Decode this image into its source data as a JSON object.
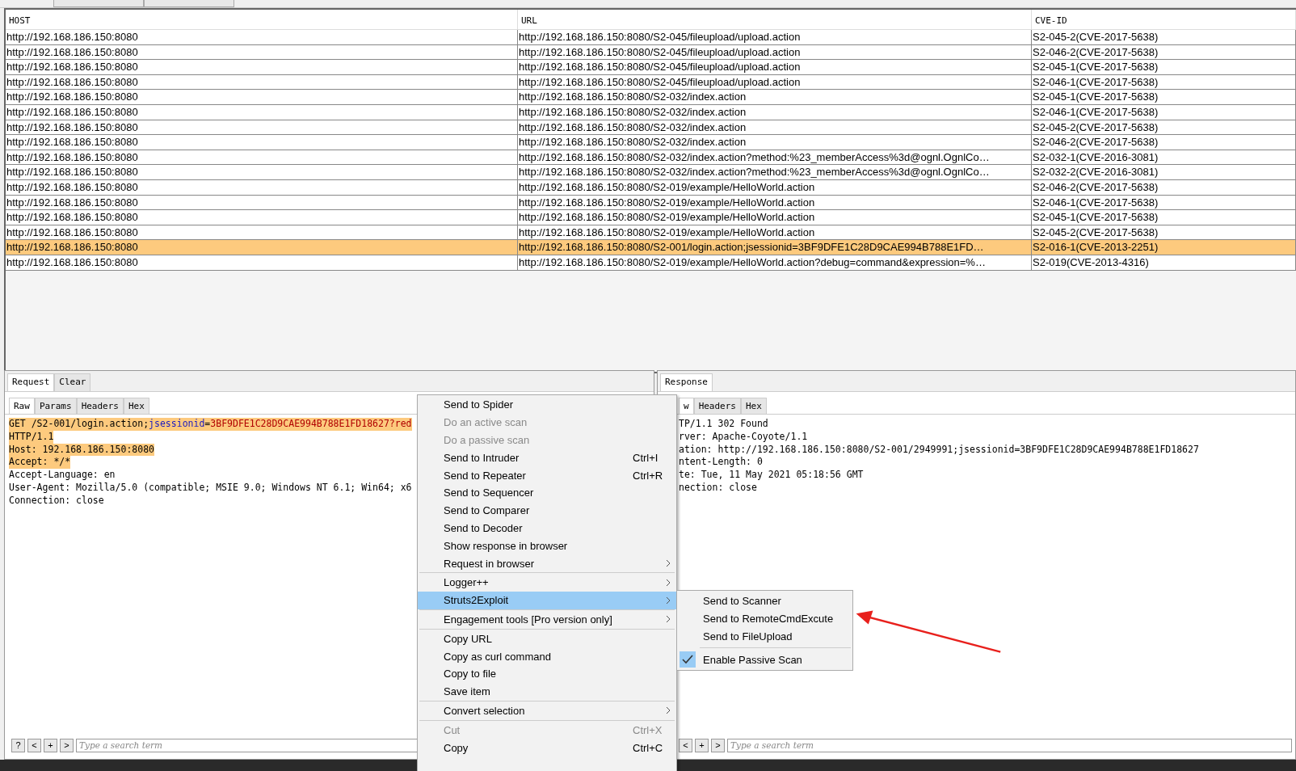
{
  "top_tabs": [
    {
      "selected": false
    },
    {
      "selected": false
    }
  ],
  "table": {
    "columns": [
      "HOST",
      "URL",
      "CVE-ID"
    ],
    "rows": [
      {
        "host": "http://192.168.186.150:8080",
        "url": "http://192.168.186.150:8080/S2-045/fileupload/upload.action",
        "cve_id": "S2-045-2(CVE-2017-5638)",
        "selected": false
      },
      {
        "host": "http://192.168.186.150:8080",
        "url": "http://192.168.186.150:8080/S2-045/fileupload/upload.action",
        "cve_id": "S2-046-2(CVE-2017-5638)",
        "selected": false
      },
      {
        "host": "http://192.168.186.150:8080",
        "url": "http://192.168.186.150:8080/S2-045/fileupload/upload.action",
        "cve_id": "S2-045-1(CVE-2017-5638)",
        "selected": false
      },
      {
        "host": "http://192.168.186.150:8080",
        "url": "http://192.168.186.150:8080/S2-045/fileupload/upload.action",
        "cve_id": "S2-046-1(CVE-2017-5638)",
        "selected": false
      },
      {
        "host": "http://192.168.186.150:8080",
        "url": "http://192.168.186.150:8080/S2-032/index.action",
        "cve_id": "S2-045-1(CVE-2017-5638)",
        "selected": false
      },
      {
        "host": "http://192.168.186.150:8080",
        "url": "http://192.168.186.150:8080/S2-032/index.action",
        "cve_id": "S2-046-1(CVE-2017-5638)",
        "selected": false
      },
      {
        "host": "http://192.168.186.150:8080",
        "url": "http://192.168.186.150:8080/S2-032/index.action",
        "cve_id": "S2-045-2(CVE-2017-5638)",
        "selected": false
      },
      {
        "host": "http://192.168.186.150:8080",
        "url": "http://192.168.186.150:8080/S2-032/index.action",
        "cve_id": "S2-046-2(CVE-2017-5638)",
        "selected": false
      },
      {
        "host": "http://192.168.186.150:8080",
        "url": "http://192.168.186.150:8080/S2-032/index.action?method:%23_memberAccess%3d@ognl.OgnlCo…",
        "cve_id": "S2-032-1(CVE-2016-3081)",
        "selected": false
      },
      {
        "host": "http://192.168.186.150:8080",
        "url": "http://192.168.186.150:8080/S2-032/index.action?method:%23_memberAccess%3d@ognl.OgnlCo…",
        "cve_id": "S2-032-2(CVE-2016-3081)",
        "selected": false
      },
      {
        "host": "http://192.168.186.150:8080",
        "url": "http://192.168.186.150:8080/S2-019/example/HelloWorld.action",
        "cve_id": "S2-046-2(CVE-2017-5638)",
        "selected": false
      },
      {
        "host": "http://192.168.186.150:8080",
        "url": "http://192.168.186.150:8080/S2-019/example/HelloWorld.action",
        "cve_id": "S2-046-1(CVE-2017-5638)",
        "selected": false
      },
      {
        "host": "http://192.168.186.150:8080",
        "url": "http://192.168.186.150:8080/S2-019/example/HelloWorld.action",
        "cve_id": "S2-045-1(CVE-2017-5638)",
        "selected": false
      },
      {
        "host": "http://192.168.186.150:8080",
        "url": "http://192.168.186.150:8080/S2-019/example/HelloWorld.action",
        "cve_id": "S2-045-2(CVE-2017-5638)",
        "selected": false
      },
      {
        "host": "http://192.168.186.150:8080",
        "url": "http://192.168.186.150:8080/S2-001/login.action;jsessionid=3BF9DFE1C28D9CAE994B788E1FD…",
        "cve_id": "S2-016-1(CVE-2013-2251)",
        "selected": true
      },
      {
        "host": "http://192.168.186.150:8080",
        "url": "http://192.168.186.150:8080/S2-019/example/HelloWorld.action?debug=command&expression=%…",
        "cve_id": "S2-019(CVE-2013-4316)",
        "selected": false
      }
    ]
  },
  "request": {
    "tabs": [
      {
        "label": "Request",
        "selected": true
      },
      {
        "label": "Clear",
        "selected": false
      }
    ],
    "subtabs": [
      {
        "label": "Raw",
        "selected": true
      },
      {
        "label": "Params",
        "selected": false
      },
      {
        "label": "Headers",
        "selected": false
      },
      {
        "label": "Hex",
        "selected": false
      }
    ],
    "lines": [
      {
        "selected": true,
        "segments": [
          {
            "kind": "plain",
            "text": "GET /S2-001/login.action;"
          },
          {
            "kind": "key",
            "text": "jsessionid"
          },
          {
            "kind": "plain",
            "text": "="
          },
          {
            "kind": "value",
            "text": "3BF9DFE1C28D9CAE994B788E1FD18627?red"
          }
        ]
      },
      {
        "selected": true,
        "segments": [
          {
            "kind": "plain",
            "text": "HTTP/1.1"
          }
        ]
      },
      {
        "selected": true,
        "segments": [
          {
            "kind": "plain",
            "text": "Host: 192.168.186.150:8080"
          }
        ]
      },
      {
        "selected": true,
        "segments": [
          {
            "kind": "plain",
            "text": "Accept: */*"
          }
        ]
      },
      {
        "selected": false,
        "segments": [
          {
            "kind": "plain",
            "text": "Accept-Language: en"
          }
        ]
      },
      {
        "selected": false,
        "segments": [
          {
            "kind": "plain",
            "text": "User-Agent: Mozilla/5.0 (compatible; MSIE 9.0; Windows NT 6.1; Win64; x6"
          }
        ]
      },
      {
        "selected": false,
        "segments": [
          {
            "kind": "plain",
            "text": "Connection: close"
          }
        ]
      }
    ],
    "search_buttons": [
      "?",
      "<",
      "+",
      ">"
    ],
    "search": {
      "placeholder": "Type a search term"
    }
  },
  "response": {
    "tabs": [
      {
        "label": "Response",
        "selected": true
      }
    ],
    "subtabs": [
      {
        "label": "w",
        "selected": true
      },
      {
        "label": "Headers",
        "selected": false
      },
      {
        "label": "Hex",
        "selected": false
      }
    ],
    "lines": [
      "TP/1.1 302 Found",
      "rver: Apache-Coyote/1.1",
      "ation: http://192.168.186.150:8080/S2-001/2949991;jsessionid=3BF9DFE1C28D9CAE994B788E1FD18627",
      "ntent-Length: 0",
      "te: Tue, 11 May 2021 05:18:56 GMT",
      "nection: close"
    ],
    "search_buttons": [
      "<",
      "+",
      ">"
    ],
    "search": {
      "placeholder": "Type a search term"
    }
  },
  "context_menu": {
    "items": [
      {
        "kind": "item",
        "label": "Send to Spider",
        "disabled": false,
        "submenu": false,
        "selected": false
      },
      {
        "kind": "item",
        "label": "Do an active scan",
        "disabled": true,
        "submenu": false,
        "selected": false
      },
      {
        "kind": "item",
        "label": "Do a passive scan",
        "disabled": true,
        "submenu": false,
        "selected": false
      },
      {
        "kind": "item",
        "label": "Send to Intruder",
        "shortcut": "Ctrl+I",
        "disabled": false,
        "submenu": false,
        "selected": false
      },
      {
        "kind": "item",
        "label": "Send to Repeater",
        "shortcut": "Ctrl+R",
        "disabled": false,
        "submenu": false,
        "selected": false
      },
      {
        "kind": "item",
        "label": "Send to Sequencer",
        "disabled": false,
        "submenu": false,
        "selected": false
      },
      {
        "kind": "item",
        "label": "Send to Comparer",
        "disabled": false,
        "submenu": false,
        "selected": false
      },
      {
        "kind": "item",
        "label": "Send to Decoder",
        "disabled": false,
        "submenu": false,
        "selected": false
      },
      {
        "kind": "item",
        "label": "Show response in browser",
        "disabled": false,
        "submenu": false,
        "selected": false
      },
      {
        "kind": "item",
        "label": "Request in browser",
        "disabled": false,
        "submenu": true,
        "selected": false
      },
      {
        "kind": "separator"
      },
      {
        "kind": "item",
        "label": "Logger++",
        "disabled": false,
        "submenu": true,
        "selected": false
      },
      {
        "kind": "item",
        "label": "Struts2Exploit",
        "disabled": false,
        "submenu": true,
        "selected": true
      },
      {
        "kind": "separator"
      },
      {
        "kind": "item",
        "label": "Engagement tools [Pro version only]",
        "disabled": false,
        "submenu": true,
        "selected": false
      },
      {
        "kind": "separator"
      },
      {
        "kind": "item",
        "label": "Copy URL",
        "disabled": false,
        "submenu": false,
        "selected": false
      },
      {
        "kind": "item",
        "label": "Copy as curl command",
        "disabled": false,
        "submenu": false,
        "selected": false
      },
      {
        "kind": "item",
        "label": "Copy to file",
        "disabled": false,
        "submenu": false,
        "selected": false
      },
      {
        "kind": "item",
        "label": "Save item",
        "disabled": false,
        "submenu": false,
        "selected": false
      },
      {
        "kind": "separator"
      },
      {
        "kind": "item",
        "label": "Convert selection",
        "disabled": false,
        "submenu": true,
        "selected": false
      },
      {
        "kind": "separator"
      },
      {
        "kind": "item",
        "label": "Cut",
        "shortcut": "Ctrl+X",
        "disabled": true,
        "submenu": false,
        "selected": false
      },
      {
        "kind": "item",
        "label": "Copy",
        "shortcut": "Ctrl+C",
        "disabled": false,
        "submenu": false,
        "selected": false
      }
    ]
  },
  "submenu": {
    "items": [
      {
        "kind": "item",
        "label": "Send to Scanner",
        "checked": false
      },
      {
        "kind": "item",
        "label": "Send to RemoteCmdExcute",
        "checked": false
      },
      {
        "kind": "item",
        "label": "Send to FileUpload",
        "checked": false
      },
      {
        "kind": "separator"
      },
      {
        "kind": "item",
        "label": "Enable Passive Scan",
        "checked": true
      }
    ]
  }
}
